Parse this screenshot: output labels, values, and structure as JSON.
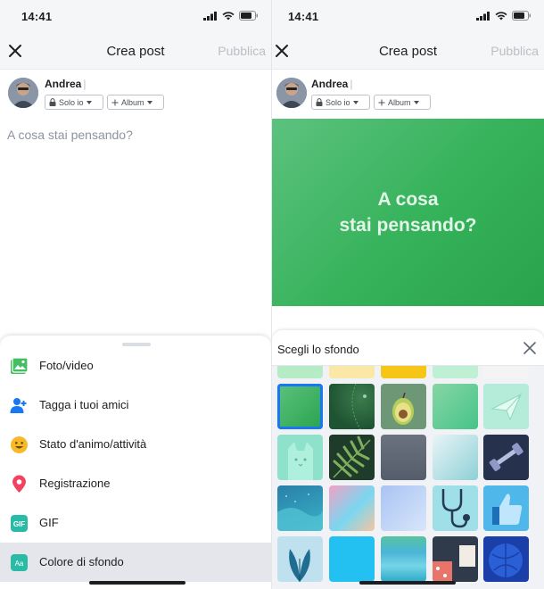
{
  "status": {
    "time": "14:41"
  },
  "header": {
    "title": "Crea post",
    "publish_label": "Pubblica"
  },
  "author": {
    "name": "Andrea",
    "privacy_label": "Solo io",
    "album_label": "Album"
  },
  "composer": {
    "placeholder": "A cosa stai pensando?"
  },
  "menu": {
    "items": [
      {
        "label": "Foto/video",
        "icon": "photo-icon"
      },
      {
        "label": "Tagga i tuoi amici",
        "icon": "tag-friends-icon"
      },
      {
        "label": "Stato d'animo/attività",
        "icon": "emoji-icon"
      },
      {
        "label": "Registrazione",
        "icon": "location-pin-icon"
      },
      {
        "label": "GIF",
        "icon": "gif-icon"
      },
      {
        "label": "Colore di sfondo",
        "icon": "text-background-icon"
      }
    ]
  },
  "right": {
    "post_text": "A cosa stai pensando?",
    "panel_title": "Scegli lo sfondo"
  },
  "colors": {
    "accent": "#1877f2",
    "post_green": "#35b25a",
    "muted": "#8d949e"
  }
}
